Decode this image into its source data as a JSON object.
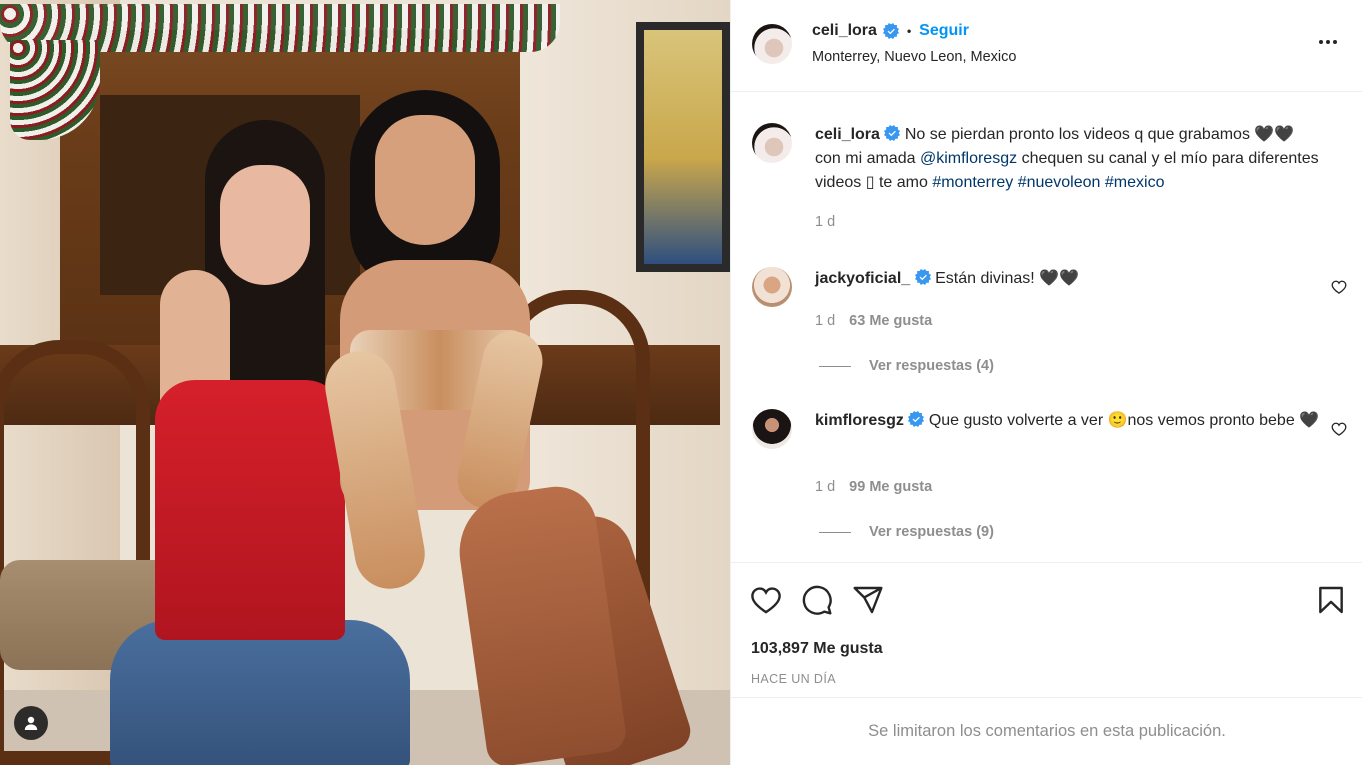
{
  "post": {
    "author": "celi_lora",
    "follow_label": "Seguir",
    "separator": "•",
    "location": "Monterrey, Nuevo Leon, Mexico",
    "caption": {
      "author": "celi_lora",
      "text_part1": "No se pierdan pronto los videos q que grabamos 🖤🖤 con mi amada",
      "mention": "@kimfloresgz",
      "text_part2": "chequen su canal y el mío para diferentes videos ▯ te amo",
      "hashtag1": "#monterrey",
      "hashtag2": "#nuevoleon",
      "hashtag3": "#mexico",
      "time": "1 d"
    },
    "likes_text": "103,897 Me gusta",
    "time_ago": "HACE UN DÍA",
    "limited_comments": "Se limitaron los comentarios en esta publicación."
  },
  "comments": [
    {
      "user": "jackyoficial_",
      "text": "Están divinas! 🖤🖤",
      "time": "1 d",
      "likes": "63 Me gusta",
      "replies": "Ver respuestas (4)"
    },
    {
      "user": "kimfloresgz",
      "text": "Que gusto volverte a ver 🙂nos vemos pronto bebe 🖤",
      "time": "1 d",
      "likes": "99 Me gusta",
      "replies": "Ver respuestas (9)"
    }
  ],
  "colors": {
    "accent": "#0095f6",
    "link": "#00376b",
    "muted": "#8e8e8e",
    "verified": "#3897f0"
  },
  "icons": [
    "verified-icon",
    "more-icon",
    "heart-icon",
    "comment-icon",
    "share-icon",
    "bookmark-icon",
    "user-tag-icon"
  ]
}
